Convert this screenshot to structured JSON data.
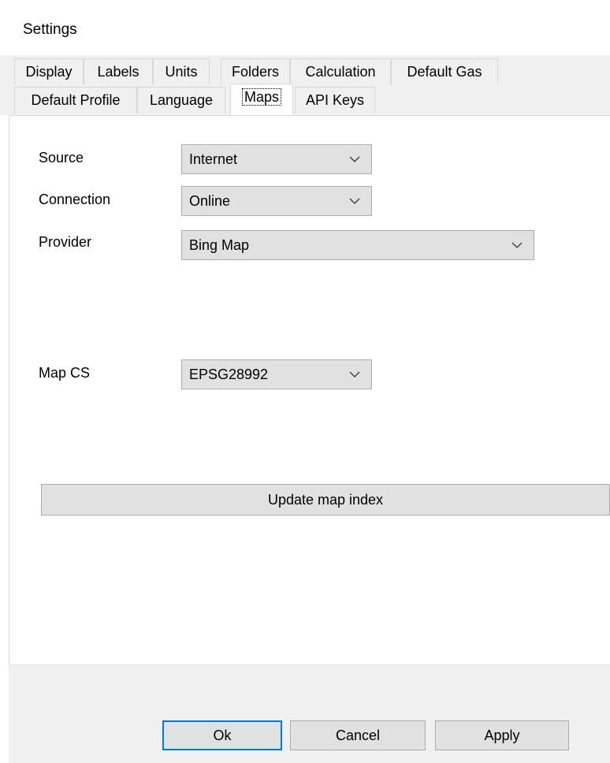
{
  "window": {
    "title": "Settings"
  },
  "tabs": {
    "row1": [
      {
        "label": "Display"
      },
      {
        "label": "Labels"
      },
      {
        "label": "Units"
      },
      {
        "label": "Folders"
      },
      {
        "label": "Calculation"
      },
      {
        "label": "Default Gas"
      }
    ],
    "row2": [
      {
        "label": "Default Profile"
      },
      {
        "label": "Language"
      },
      {
        "label": "Maps",
        "selected": true
      },
      {
        "label": "API Keys"
      }
    ]
  },
  "maps": {
    "source": {
      "label": "Source",
      "value": "Internet"
    },
    "connection": {
      "label": "Connection",
      "value": "Online"
    },
    "provider": {
      "label": "Provider",
      "value": "Bing Map"
    },
    "map_cs": {
      "label": "Map CS",
      "value": "EPSG28992"
    },
    "update_button": "Update map index"
  },
  "footer": {
    "ok": "Ok",
    "cancel": "Cancel",
    "apply": "Apply"
  },
  "icons": {
    "dropdown": "chevron-down-icon"
  }
}
